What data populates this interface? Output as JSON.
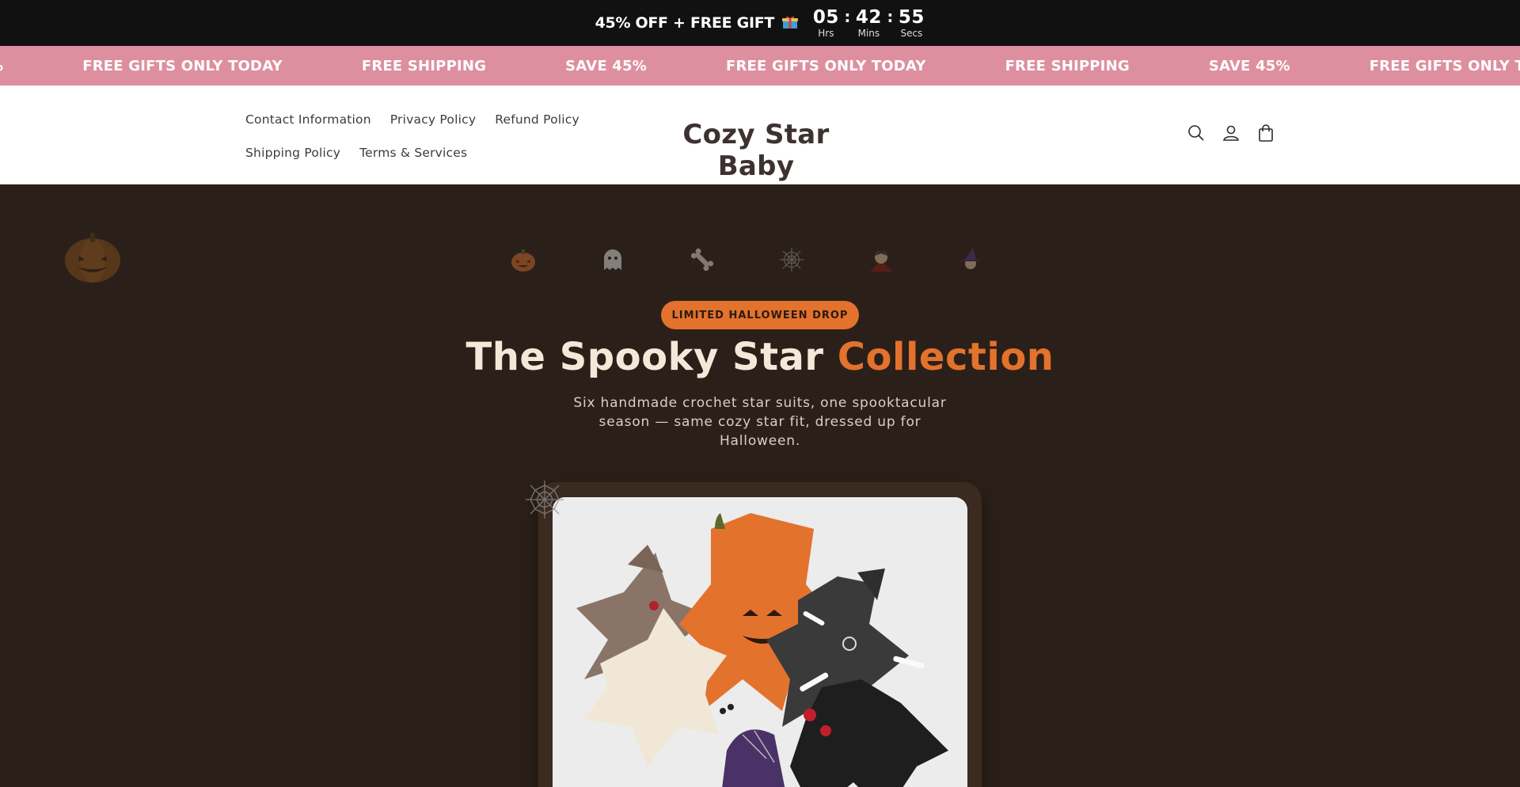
{
  "topbar": {
    "promo_text": "45% OFF + FREE GIFT",
    "gift_icon": "gift-icon",
    "timer": {
      "hours": "05",
      "hours_label": "Hrs",
      "minutes": "42",
      "minutes_label": "Mins",
      "seconds": "55",
      "seconds_label": "Secs",
      "separator": ":"
    }
  },
  "marquee": {
    "items": [
      "%",
      "FREE GIFTS ONLY TODAY",
      "FREE SHIPPING",
      "SAVE 45%",
      "FREE GIFTS ONLY TODAY",
      "FREE SHIPPING",
      "SAVE 45%",
      "FREE GIFTS ONLY TODAY"
    ],
    "background": "#dd8fa0"
  },
  "header": {
    "nav": [
      {
        "label": "Contact Information"
      },
      {
        "label": "Privacy Policy"
      },
      {
        "label": "Refund Policy"
      },
      {
        "label": "Shipping Policy"
      },
      {
        "label": "Terms & Services"
      }
    ],
    "logo": "Cozy Star Baby",
    "icons": [
      "search-icon",
      "account-icon",
      "cart-icon"
    ]
  },
  "hero": {
    "badge": "LIMITED HALLOWEEN DROP",
    "title_main": "The Spooky Star",
    "title_accent": "Collection",
    "subtitle": "Six handmade crochet star suits, one spooktacular season — same cozy star fit, dressed up for Halloween.",
    "emoji_icons": [
      "pumpkin-icon",
      "ghost-icon",
      "bone-icon",
      "spiderweb-icon",
      "vampire-icon",
      "witch-icon"
    ],
    "accent_color": "#e3722d",
    "background": "#2b2019",
    "image_alt": "crochet-star-suits-product-photo"
  }
}
